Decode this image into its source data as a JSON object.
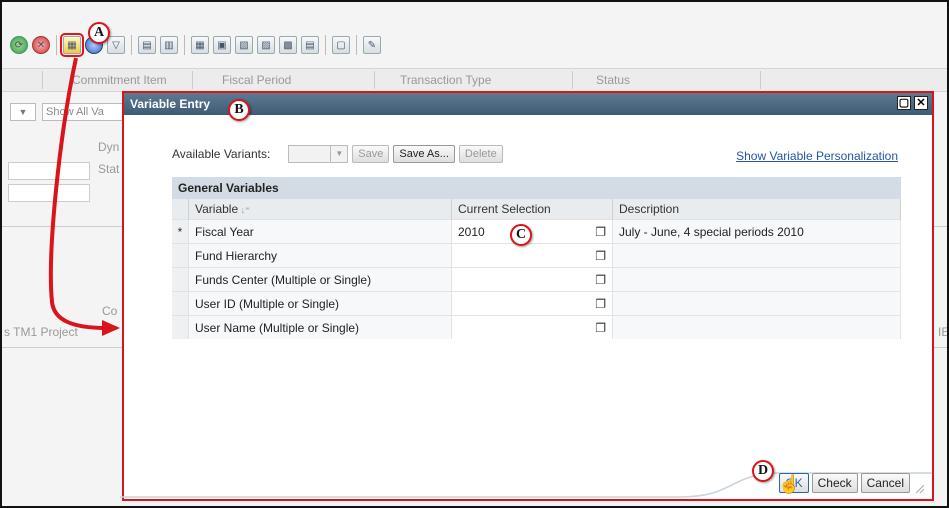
{
  "toolbar": {
    "icons": [
      "refresh-icon",
      "stop-icon",
      "variable-entry-icon",
      "info-icon",
      "filter-icon",
      "copy-icon",
      "chart-icon",
      "table-icon",
      "layout-icon",
      "export-icon",
      "graph-icon",
      "settings-icon",
      "print-icon",
      "window-icon",
      "edit-icon"
    ]
  },
  "background": {
    "columns": [
      "Commitment Item",
      "Fiscal Period",
      "Transaction Type",
      "Status"
    ],
    "show_all": "Show All Va",
    "label_dyn": "Dyn",
    "label_stat": "Stat",
    "label_con": "Co",
    "label_project": "s TM1 Project"
  },
  "dialog": {
    "title": "Variable Entry",
    "variants_label": "Available Variants:",
    "save": "Save",
    "save_as": "Save As...",
    "delete": "Delete",
    "personalization_link": "Show Variable Personalization",
    "section_title": "General Variables",
    "columns": {
      "variable": "Variable",
      "current": "Current Selection",
      "description": "Description"
    },
    "rows": [
      {
        "mandatory": "*",
        "variable": "Fiscal Year",
        "value": "2010",
        "description": "July - June, 4 special periods 2010"
      },
      {
        "mandatory": "",
        "variable": "Fund Hierarchy",
        "value": "",
        "description": ""
      },
      {
        "mandatory": "",
        "variable": "Funds Center (Multiple or Single)",
        "value": "",
        "description": ""
      },
      {
        "mandatory": "",
        "variable": "User ID (Multiple or Single)",
        "value": "",
        "description": ""
      },
      {
        "mandatory": "",
        "variable": "User Name (Multiple or Single)",
        "value": "",
        "description": ""
      }
    ],
    "ok": "OK",
    "check": "Check",
    "cancel": "Cancel"
  },
  "callouts": [
    "A",
    "B",
    "C",
    "D"
  ],
  "colors": {
    "accent_red": "#d9141b",
    "title_bar": "#4a6680",
    "link": "#2356a3"
  }
}
